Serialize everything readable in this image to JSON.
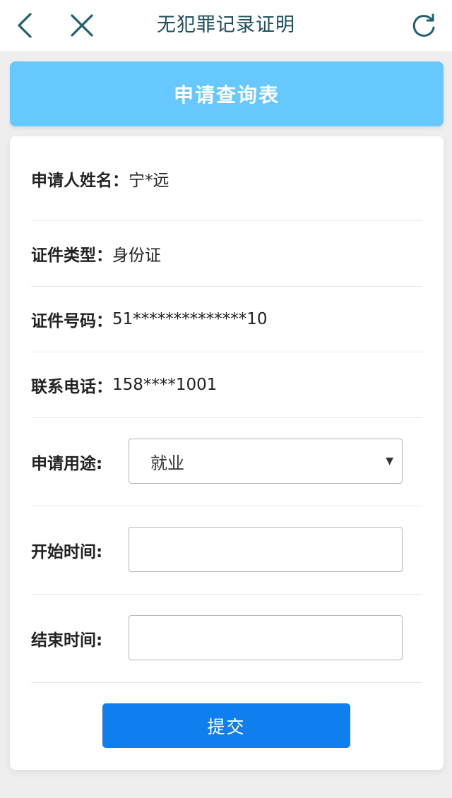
{
  "navbar": {
    "title": "无犯罪记录证明",
    "back_icon": "chevron-left-icon",
    "close_icon": "close-icon",
    "refresh_icon": "refresh-icon",
    "icon_color": "#1f5f6e"
  },
  "banner": {
    "title": "申请查询表",
    "color": "#67c8fe"
  },
  "form": {
    "applicant_name": {
      "label": "申请人姓名：",
      "value": "宁*远"
    },
    "id_type": {
      "label": "证件类型：",
      "value": "身份证"
    },
    "id_number": {
      "label": "证件号码：",
      "value": "51**************10"
    },
    "phone": {
      "label": "联系电话：",
      "value": "158****1001"
    },
    "purpose": {
      "label": "申请用途:",
      "selected": "就业"
    },
    "start_time": {
      "label": "开始时间:",
      "value": ""
    },
    "end_time": {
      "label": "结束时间:",
      "value": ""
    }
  },
  "submit": {
    "label": "提交",
    "color": "#0f7ff0"
  }
}
